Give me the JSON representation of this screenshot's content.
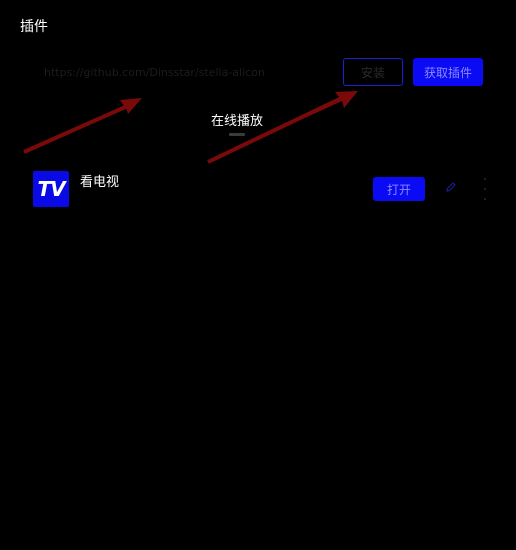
{
  "window": {
    "title": "插件"
  },
  "toolbar": {
    "url_placeholder": "https://github.com/Dinsstar/stella-alicon",
    "install_label": "安装",
    "get_plugin_label": "获取插件"
  },
  "tabs": [
    {
      "label": "在线播放",
      "active": true
    }
  ],
  "plugins": [
    {
      "logo_text": "TV",
      "name": "看电视",
      "open_label": "打开"
    }
  ],
  "colors": {
    "background": "#000000",
    "accent": "#0a0af5",
    "annotation_arrow": "#7a0a0a"
  }
}
